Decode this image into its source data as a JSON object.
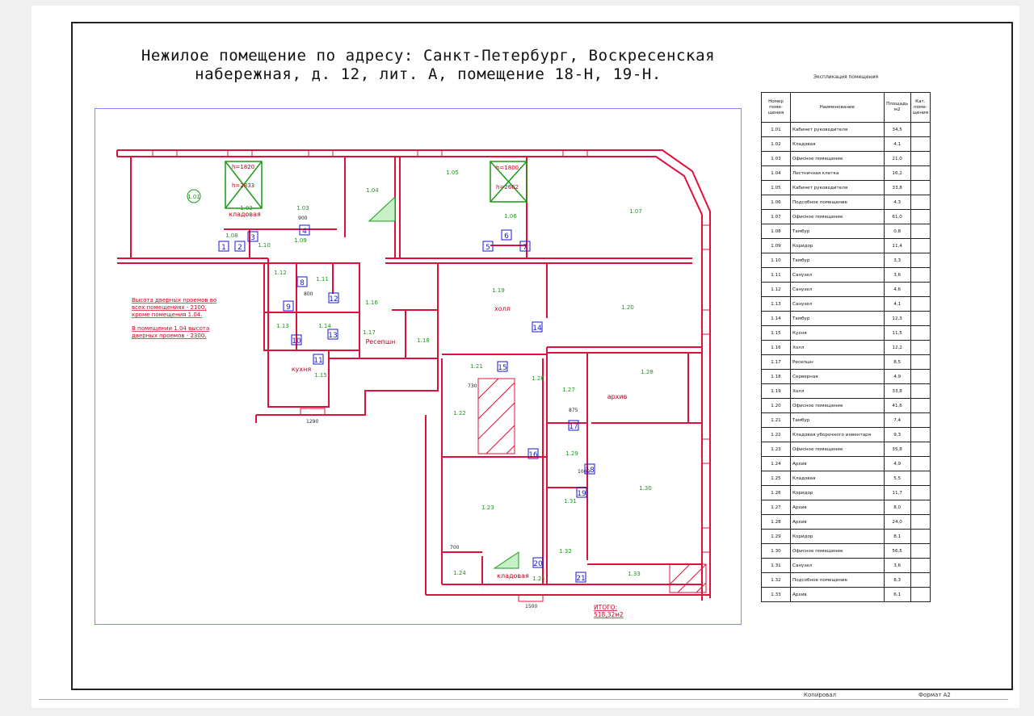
{
  "title": {
    "line1": "Нежилое помещение по адресу: Санкт-Петербург, Воскресенская",
    "line2": "набережная, д. 12, лит. А, помещение 18-Н, 19-Н."
  },
  "plan": {
    "notes": {
      "line1": "Высота дверных проемов во",
      "line2": "всех помещениях - 2100,",
      "line3": "кроме помещения 1.04.",
      "line4": "В помещении 1.04 высота",
      "line5": "дверных проемов - 2300."
    },
    "total_label": "ИТОГО:",
    "total_value": "518,32м2",
    "room_labels": {
      "r101": "1.01",
      "r102": "1.02",
      "r103": "1.03",
      "r104": "1.04",
      "r105": "1.05",
      "r106": "1.06",
      "r107": "1.07",
      "r108": "1.08",
      "r109": "1.09",
      "r111": "1.11",
      "r112": "1.12",
      "r113": "1.13",
      "r114": "1.14",
      "r115": "1.15",
      "r116": "1.16",
      "r117": "1.17",
      "r118": "1.18",
      "r119": "1.19",
      "r120": "1.20",
      "r121": "1.21",
      "r122": "1.22",
      "r123": "1.23",
      "r124": "1.24",
      "r125": "1.25",
      "r126": "1.26",
      "r127": "1.27",
      "r128": "1.28",
      "r129": "1.29",
      "r130": "1.30",
      "r131": "1.31",
      "r132": "1.32",
      "r133": "1.33",
      "r110": "1.10"
    },
    "room_names": {
      "kladovaya1": "кладовая",
      "holl": "холл",
      "reception": "Ресепшн",
      "kuhnya": "кухня",
      "arhiv": "архив",
      "kladovaya2": "кладовая"
    },
    "heights": {
      "h1": "h=1820",
      "h2": "h=2833",
      "h3": "h=1800",
      "h4": "h=2662"
    },
    "dims": {
      "d1290": "1290",
      "d1500": "1500",
      "d900": "900",
      "d875": "875",
      "d700": "700",
      "d800": "800",
      "d730": "730",
      "d1000": "1000"
    },
    "door_numbers": [
      "1",
      "2",
      "3",
      "4",
      "5",
      "6",
      "7",
      "8",
      "9",
      "10",
      "11",
      "12",
      "13",
      "14",
      "15",
      "16",
      "17",
      "18",
      "19",
      "20",
      "21"
    ]
  },
  "explication": {
    "title": "Экспликация помещения",
    "headers": {
      "num": "Номер поме-щения",
      "name": "Наименование",
      "area": "Площадь м2",
      "cat": "Кат. поме-щения"
    },
    "rows": [
      {
        "num": "1.01",
        "name": "Кабинет руководителя",
        "area": "34,5"
      },
      {
        "num": "1.02",
        "name": "Кладовая",
        "area": "4,1"
      },
      {
        "num": "1.03",
        "name": "Офисное помещение",
        "area": "21,0"
      },
      {
        "num": "1.04",
        "name": "Лестничная клетка",
        "area": "16,2"
      },
      {
        "num": "1.05",
        "name": "Кабинет руководителя",
        "area": "33,8"
      },
      {
        "num": "1.06",
        "name": "Подсобное помещение",
        "area": "4,3"
      },
      {
        "num": "1.07",
        "name": "Офисное помещение",
        "area": "61,0"
      },
      {
        "num": "1.08",
        "name": "Тамбур",
        "area": "0,8"
      },
      {
        "num": "1.09",
        "name": "Коридор",
        "area": "11,4"
      },
      {
        "num": "1.10",
        "name": "Тамбур",
        "area": "3,3"
      },
      {
        "num": "1.11",
        "name": "Санузел",
        "area": "3,6"
      },
      {
        "num": "1.12",
        "name": "Санузел",
        "area": "4,6"
      },
      {
        "num": "1.13",
        "name": "Санузел",
        "area": "4,1"
      },
      {
        "num": "1.14",
        "name": "Тамбур",
        "area": "12,3"
      },
      {
        "num": "1.15",
        "name": "Кухня",
        "area": "11,5"
      },
      {
        "num": "1.16",
        "name": "Холл",
        "area": "12,2"
      },
      {
        "num": "1.17",
        "name": "Ресепшн",
        "area": "8,5"
      },
      {
        "num": "1.18",
        "name": "Серверная",
        "area": "4,9"
      },
      {
        "num": "1.19",
        "name": "Холл",
        "area": "33,8"
      },
      {
        "num": "1.20",
        "name": "Офисное помещение",
        "area": "41,6"
      },
      {
        "num": "1.21",
        "name": "Тамбур",
        "area": "7,4"
      },
      {
        "num": "1.22",
        "name": "Кладовая уборочного инвентаря",
        "area": "9,3"
      },
      {
        "num": "1.23",
        "name": "Офисное помещение",
        "area": "35,8"
      },
      {
        "num": "1.24",
        "name": "Архив",
        "area": "4,9"
      },
      {
        "num": "1.25",
        "name": "Кладовая",
        "area": "5,5"
      },
      {
        "num": "1.26",
        "name": "Коридор",
        "area": "11,7"
      },
      {
        "num": "1.27",
        "name": "Архив",
        "area": "8,0"
      },
      {
        "num": "1.28",
        "name": "Архив",
        "area": "24,0"
      },
      {
        "num": "1.29",
        "name": "Коридор",
        "area": "8,1"
      },
      {
        "num": "1.30",
        "name": "Офисное помещение",
        "area": "56,5"
      },
      {
        "num": "1.31",
        "name": "Санузел",
        "area": "3,6"
      },
      {
        "num": "1.32",
        "name": "Подсобное помещение",
        "area": "8,3"
      },
      {
        "num": "1.33",
        "name": "Архив",
        "area": "6,1"
      }
    ]
  },
  "footer": {
    "copied": "Копировал",
    "format": "Формат А2"
  }
}
